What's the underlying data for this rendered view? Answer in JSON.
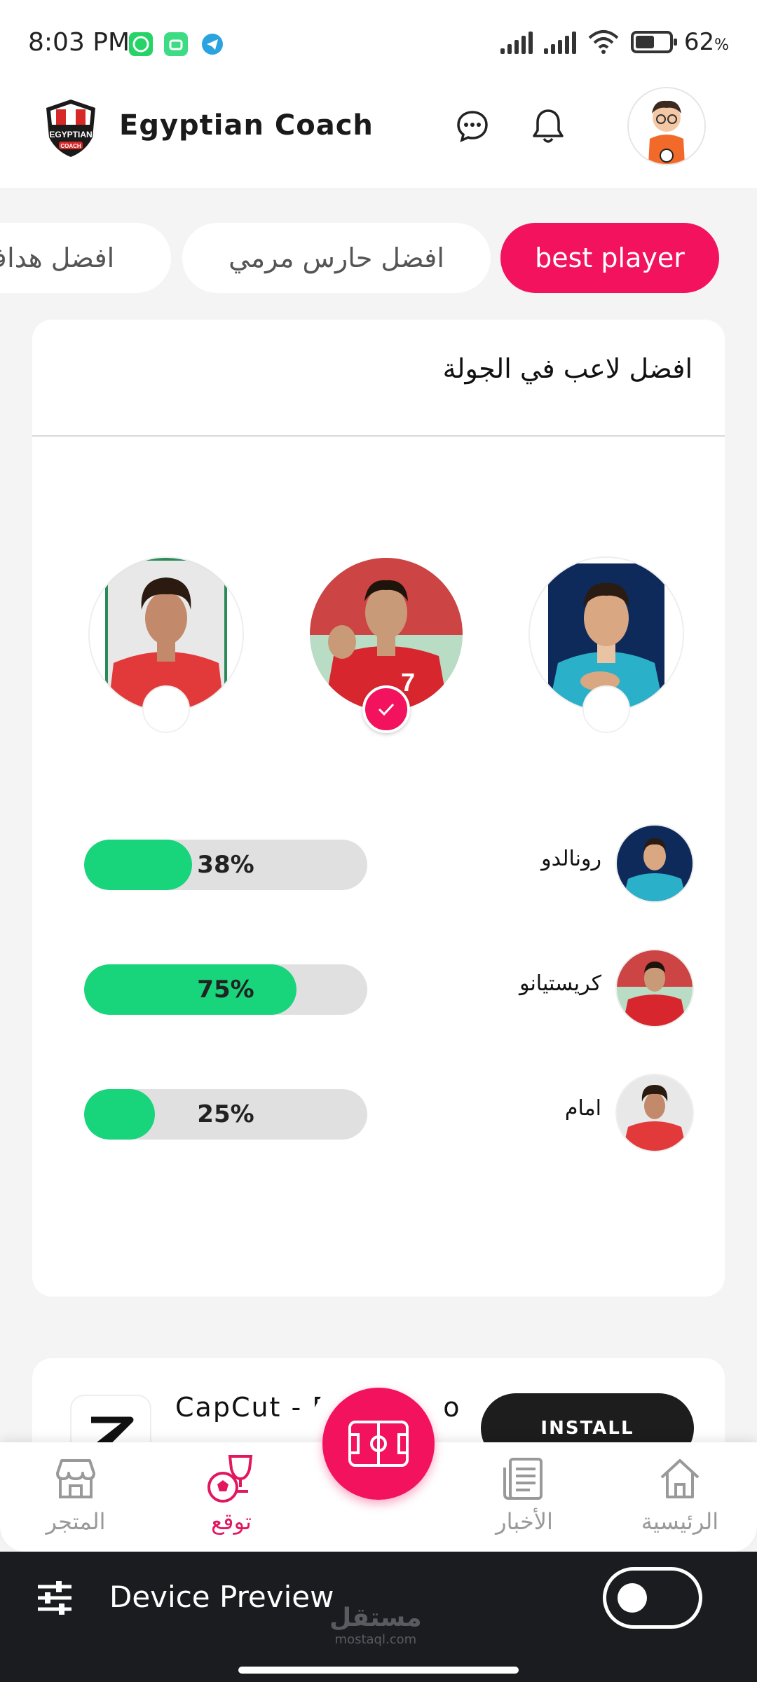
{
  "status": {
    "time": "8:03 PM",
    "battery_pct": "62",
    "battery_unit": "%",
    "battery_level": 0.62,
    "notification_icons": [
      "whatsapp-icon",
      "android-icon",
      "telegram-icon"
    ]
  },
  "header": {
    "app_title": "Egyptian Coach",
    "logo_line1": "EGYPTIAN",
    "logo_line2": "COACH"
  },
  "tabs": [
    {
      "label": "best player",
      "active": true
    },
    {
      "label": "افضل حارس مرمي",
      "active": false
    },
    {
      "label": "افضل هداف",
      "active": false
    }
  ],
  "poll": {
    "title": "افضل لاعب في الجولة",
    "choices": [
      {
        "id": "ronaldo-real",
        "selected": false,
        "jersey_color": "#2bb0c9"
      },
      {
        "id": "cristiano-portugal",
        "selected": true,
        "jersey_color": "#d8262f"
      },
      {
        "id": "emam-ahly",
        "selected": false,
        "jersey_color": "#e23a3a"
      }
    ],
    "results": [
      {
        "name": "رونالدو",
        "percent": 38,
        "percent_label": "38%"
      },
      {
        "name": "كريستيانو",
        "percent": 75,
        "percent_label": "75%"
      },
      {
        "name": "امام",
        "percent": 25,
        "percent_label": "25%"
      }
    ]
  },
  "ad": {
    "title": "CapCut - Edit Video",
    "install_label": "INSTALL"
  },
  "bottom_nav": {
    "items": [
      {
        "label": "الرئيسية",
        "icon": "home-icon",
        "active": false
      },
      {
        "label": "الأخبار",
        "icon": "newspaper-icon",
        "active": false
      },
      {
        "label": "توقع",
        "icon": "trophy-ball-icon",
        "active": true
      },
      {
        "label": "المتجر",
        "icon": "store-icon",
        "active": false
      }
    ],
    "center_icon": "football-pitch-icon"
  },
  "device_preview": {
    "label": "Device Preview",
    "enabled": false
  },
  "watermark": {
    "main": "مستقل",
    "sub": "mostaql.com"
  },
  "colors": {
    "accent": "#f2125e",
    "progress_fill": "#18d47b",
    "progress_track": "#e0e0e0",
    "preview_bar": "#1b1c20"
  }
}
